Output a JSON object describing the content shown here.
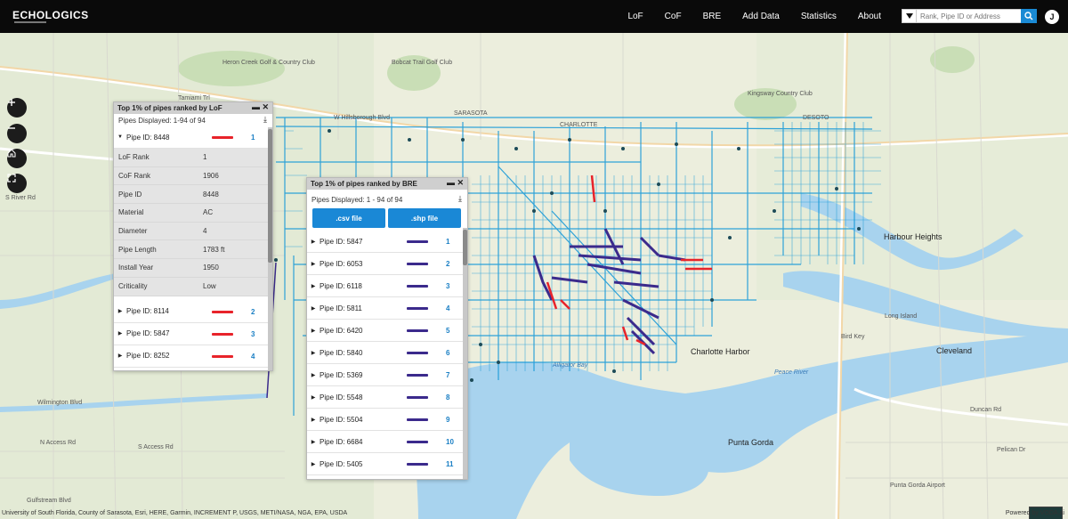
{
  "navbar": {
    "logo": "ECHOLOGICS",
    "links": [
      "LoF",
      "CoF",
      "BRE",
      "Add Data",
      "Statistics",
      "About"
    ],
    "search_placeholder": "Rank, Pipe ID or Address",
    "user_initial": "J"
  },
  "map_labels": {
    "harbour_heights": "Harbour Heights",
    "charlotte_harbor": "Charlotte Harbor",
    "punta_gorda": "Punta Gorda",
    "cleveland": "Cleveland",
    "long_island": "Long Island",
    "bird_key": "Bird Key",
    "alligator_bay": "Alligator Bay",
    "peace_river": "Peace River",
    "sarasota": "SARASOTA",
    "charlotte": "CHARLOTTE",
    "desoto": "DESOTO",
    "kingsway": "Kingsway Country Club",
    "heron_creek": "Heron Creek Golf & Country Club",
    "bobcat": "Bobcat Trail Golf Club",
    "hillsborough": "W Hillsborough Blvd",
    "tamiami": "Tamiami Trl",
    "s_access": "S Access Rd",
    "gulfstream": "Gulfstream Blvd",
    "wilmington": "Wilmington Blvd",
    "n_access": "N Access Rd",
    "river_rd": "S River Rd",
    "duncan": "Duncan Rd",
    "punta_gorda_airport": "Punta Gorda Airport",
    "burnt_store": "Burnt Store Rd",
    "pelican_dr": "Pelican Dr",
    "sr31": "SR-31"
  },
  "lof_panel": {
    "title": "Top 1% of pipes ranked by LoF",
    "subtitle": "Pipes Displayed: 1-94 of 94",
    "expanded": {
      "label": "Pipe ID: 8448",
      "rank": "1",
      "details": [
        {
          "k": "LoF Rank",
          "v": "1"
        },
        {
          "k": "CoF Rank",
          "v": "1906"
        },
        {
          "k": "Pipe ID",
          "v": "8448"
        },
        {
          "k": "Material",
          "v": "AC"
        },
        {
          "k": "Diameter",
          "v": "4"
        },
        {
          "k": "Pipe Length",
          "v": "1783 ft"
        },
        {
          "k": "Install Year",
          "v": "1950"
        },
        {
          "k": "Criticality",
          "v": "Low"
        }
      ]
    },
    "rows": [
      {
        "label": "Pipe ID: 8114",
        "rank": "2"
      },
      {
        "label": "Pipe ID: 5847",
        "rank": "3"
      },
      {
        "label": "Pipe ID: 8252",
        "rank": "4"
      }
    ],
    "line_color": "#e8232a"
  },
  "bre_panel": {
    "title": "Top 1% of pipes ranked by BRE",
    "subtitle": "Pipes Displayed: 1 - 94 of 94",
    "csv_label": ".csv file",
    "shp_label": ".shp file",
    "rows": [
      {
        "label": "Pipe ID: 5847",
        "rank": "1"
      },
      {
        "label": "Pipe ID: 6053",
        "rank": "2"
      },
      {
        "label": "Pipe ID: 6118",
        "rank": "3"
      },
      {
        "label": "Pipe ID: 5811",
        "rank": "4"
      },
      {
        "label": "Pipe ID: 6420",
        "rank": "5"
      },
      {
        "label": "Pipe ID: 5840",
        "rank": "6"
      },
      {
        "label": "Pipe ID: 5369",
        "rank": "7"
      },
      {
        "label": "Pipe ID: 5548",
        "rank": "8"
      },
      {
        "label": "Pipe ID: 5504",
        "rank": "9"
      },
      {
        "label": "Pipe ID: 6684",
        "rank": "10"
      },
      {
        "label": "Pipe ID: 5405",
        "rank": "11"
      }
    ],
    "line_color": "#3b2a8c"
  },
  "footer": {
    "attribution": "University of South Florida, County of Sarasota, Esri, HERE, Garmin, INCREMENT P, USGS, METI/NASA, NGA, EPA, USDA",
    "powered": "Powered by VODA.ai"
  },
  "colors": {
    "pipe": "#1a9ad8",
    "water": "#a8d3ee",
    "accent": "#1a88d6"
  }
}
